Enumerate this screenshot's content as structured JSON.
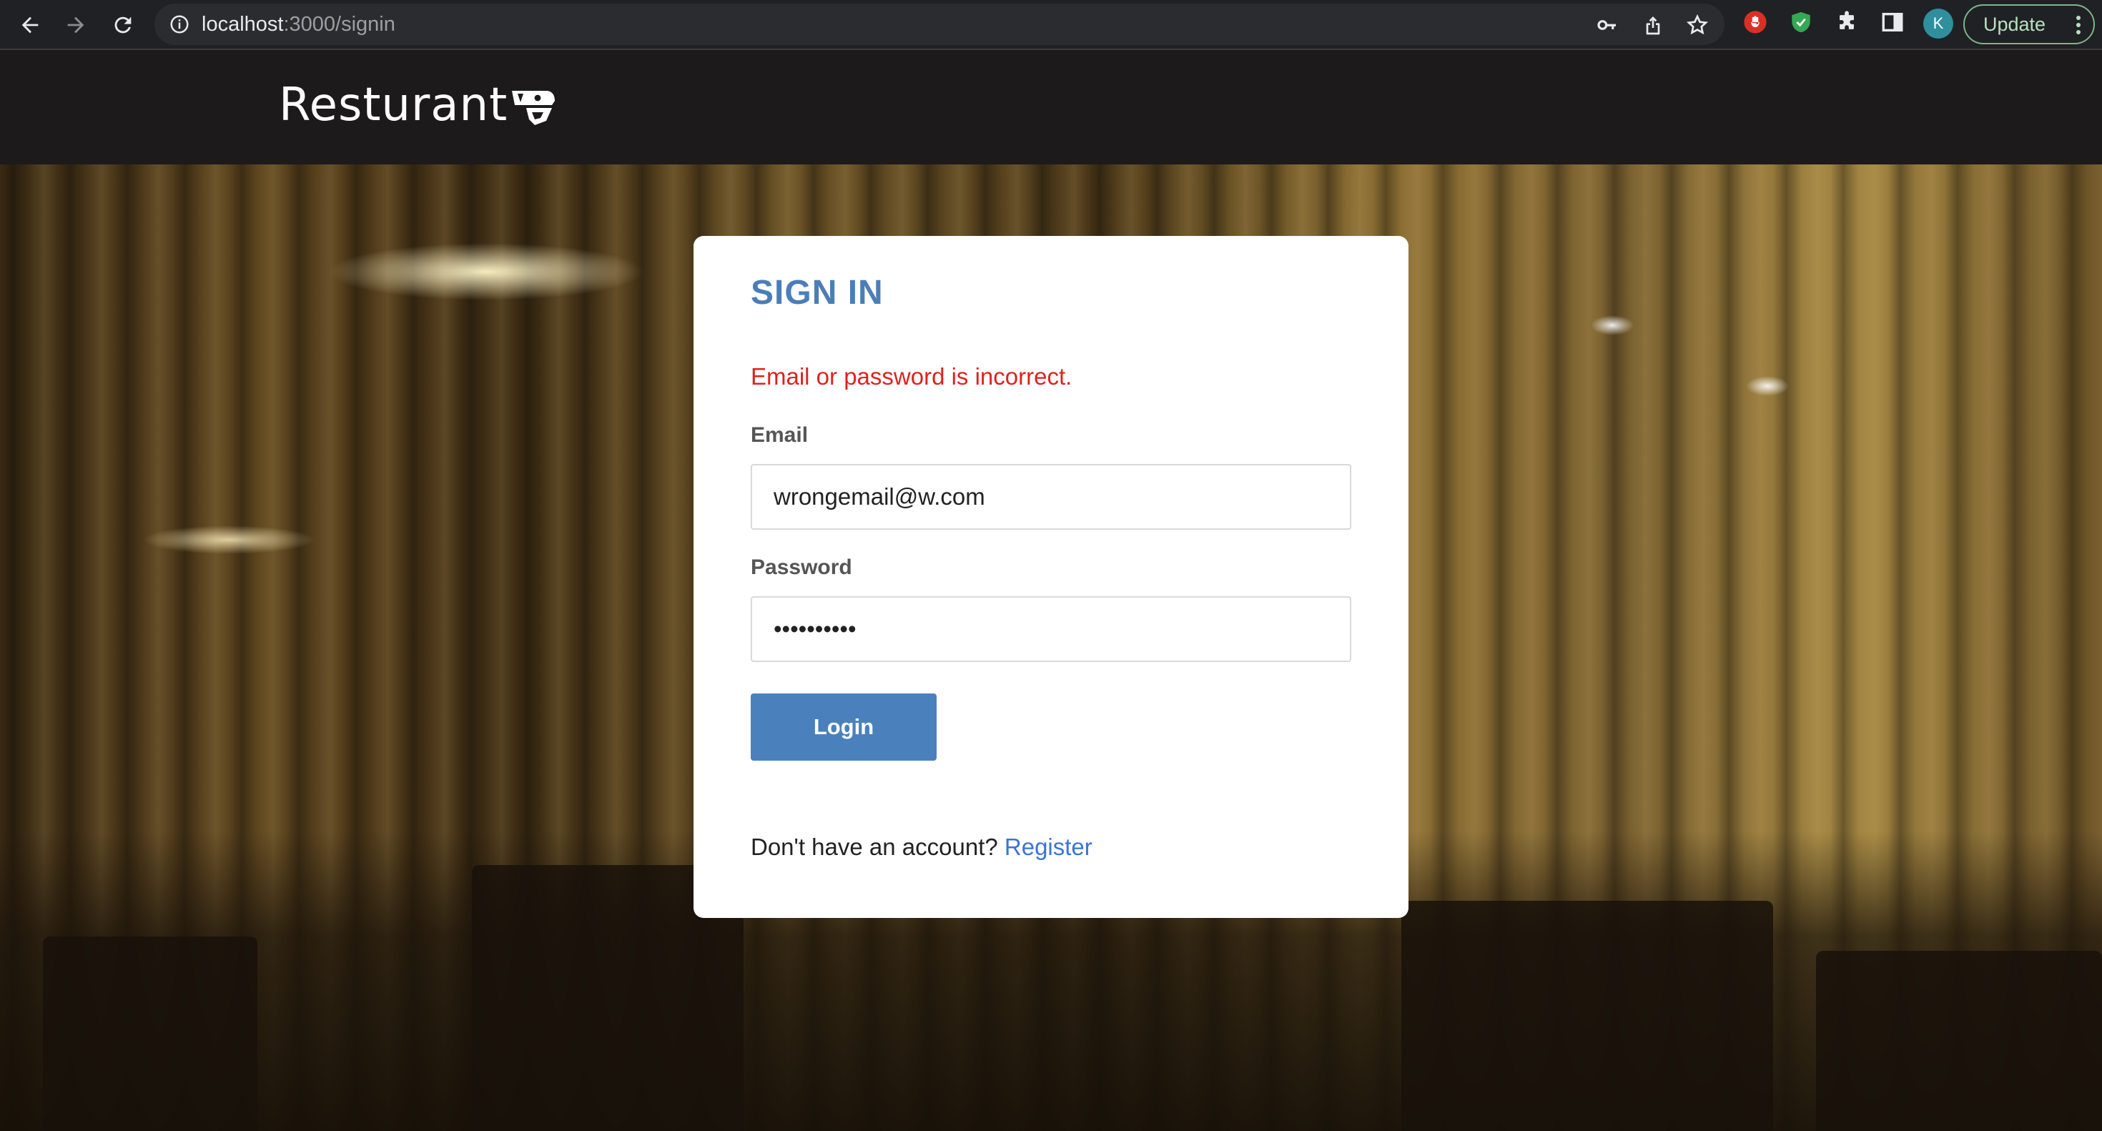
{
  "browser": {
    "url_host": "localhost",
    "url_path": ":3000/signin",
    "profile_initial": "K",
    "update_label": "Update",
    "icons": [
      "back-icon",
      "forward-icon",
      "reload-icon",
      "site-info-icon",
      "key-icon",
      "share-icon",
      "bookmark-star-icon",
      "extension-red-icon",
      "extension-shield-icon",
      "extensions-puzzle-icon",
      "side-panel-icon",
      "kebab-menu-icon"
    ]
  },
  "header": {
    "brand": "Resturant"
  },
  "signin": {
    "title": "SIGN IN",
    "error": "Email or password is incorrect.",
    "email_label": "Email",
    "email_value": "wrongemail@w.com",
    "password_label": "Password",
    "password_value": "••••••••••",
    "login_label": "Login",
    "register_prompt": "Don't have an account?",
    "register_link": "Register"
  },
  "colors": {
    "title": "#4a7eb8",
    "error": "#e0221e",
    "button": "#4a81bd",
    "link": "#3b74d6",
    "header_bg": "#1c1a1b"
  }
}
